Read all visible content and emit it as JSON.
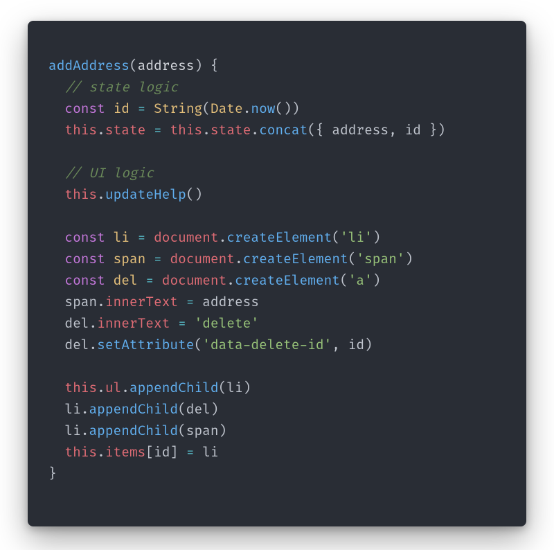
{
  "colors": {
    "bg": "#292d35",
    "fn": "#61afef",
    "comment": "#6b8a5a",
    "keyword": "#c678dd",
    "variable": "#e5c07b",
    "class": "#e5c07b",
    "operator": "#56b6c2",
    "this": "#e06c75",
    "prop": "#e06c75",
    "object": "#e06c75",
    "string": "#98c379",
    "default": "#c0c5ce"
  },
  "code": {
    "lines": [
      [
        {
          "cls": "c-fn",
          "t": "addAddress"
        },
        {
          "cls": "c-punct",
          "t": "("
        },
        {
          "cls": "c-param",
          "t": "address"
        },
        {
          "cls": "c-punct",
          "t": ") {"
        }
      ],
      [
        {
          "cls": "c-punct",
          "t": "  "
        },
        {
          "cls": "c-comment",
          "t": "// state logic"
        }
      ],
      [
        {
          "cls": "c-punct",
          "t": "  "
        },
        {
          "cls": "c-kw",
          "t": "const"
        },
        {
          "cls": "c-punct",
          "t": " "
        },
        {
          "cls": "c-var",
          "t": "id"
        },
        {
          "cls": "c-punct",
          "t": " "
        },
        {
          "cls": "c-op",
          "t": "="
        },
        {
          "cls": "c-punct",
          "t": " "
        },
        {
          "cls": "c-cls",
          "t": "String"
        },
        {
          "cls": "c-punct",
          "t": "("
        },
        {
          "cls": "c-cls",
          "t": "Date"
        },
        {
          "cls": "c-punct",
          "t": "."
        },
        {
          "cls": "c-fn",
          "t": "now"
        },
        {
          "cls": "c-punct",
          "t": "())"
        }
      ],
      [
        {
          "cls": "c-punct",
          "t": "  "
        },
        {
          "cls": "c-this",
          "t": "this"
        },
        {
          "cls": "c-punct",
          "t": "."
        },
        {
          "cls": "c-prop",
          "t": "state"
        },
        {
          "cls": "c-punct",
          "t": " "
        },
        {
          "cls": "c-op",
          "t": "="
        },
        {
          "cls": "c-punct",
          "t": " "
        },
        {
          "cls": "c-this",
          "t": "this"
        },
        {
          "cls": "c-punct",
          "t": "."
        },
        {
          "cls": "c-prop",
          "t": "state"
        },
        {
          "cls": "c-punct",
          "t": "."
        },
        {
          "cls": "c-fn",
          "t": "concat"
        },
        {
          "cls": "c-punct",
          "t": "({ address, id })"
        }
      ],
      [
        {
          "cls": "c-punct",
          "t": ""
        }
      ],
      [
        {
          "cls": "c-punct",
          "t": "  "
        },
        {
          "cls": "c-comment",
          "t": "// UI logic"
        }
      ],
      [
        {
          "cls": "c-punct",
          "t": "  "
        },
        {
          "cls": "c-this",
          "t": "this"
        },
        {
          "cls": "c-punct",
          "t": "."
        },
        {
          "cls": "c-fn",
          "t": "updateHelp"
        },
        {
          "cls": "c-punct",
          "t": "()"
        }
      ],
      [
        {
          "cls": "c-punct",
          "t": ""
        }
      ],
      [
        {
          "cls": "c-punct",
          "t": "  "
        },
        {
          "cls": "c-kw",
          "t": "const"
        },
        {
          "cls": "c-punct",
          "t": " "
        },
        {
          "cls": "c-var",
          "t": "li"
        },
        {
          "cls": "c-punct",
          "t": " "
        },
        {
          "cls": "c-op",
          "t": "="
        },
        {
          "cls": "c-punct",
          "t": " "
        },
        {
          "cls": "c-obj",
          "t": "document"
        },
        {
          "cls": "c-punct",
          "t": "."
        },
        {
          "cls": "c-fn",
          "t": "createElement"
        },
        {
          "cls": "c-punct",
          "t": "("
        },
        {
          "cls": "c-str",
          "t": "'li'"
        },
        {
          "cls": "c-punct",
          "t": ")"
        }
      ],
      [
        {
          "cls": "c-punct",
          "t": "  "
        },
        {
          "cls": "c-kw",
          "t": "const"
        },
        {
          "cls": "c-punct",
          "t": " "
        },
        {
          "cls": "c-var",
          "t": "span"
        },
        {
          "cls": "c-punct",
          "t": " "
        },
        {
          "cls": "c-op",
          "t": "="
        },
        {
          "cls": "c-punct",
          "t": " "
        },
        {
          "cls": "c-obj",
          "t": "document"
        },
        {
          "cls": "c-punct",
          "t": "."
        },
        {
          "cls": "c-fn",
          "t": "createElement"
        },
        {
          "cls": "c-punct",
          "t": "("
        },
        {
          "cls": "c-str",
          "t": "'span'"
        },
        {
          "cls": "c-punct",
          "t": ")"
        }
      ],
      [
        {
          "cls": "c-punct",
          "t": "  "
        },
        {
          "cls": "c-kw",
          "t": "const"
        },
        {
          "cls": "c-punct",
          "t": " "
        },
        {
          "cls": "c-var",
          "t": "del"
        },
        {
          "cls": "c-punct",
          "t": " "
        },
        {
          "cls": "c-op",
          "t": "="
        },
        {
          "cls": "c-punct",
          "t": " "
        },
        {
          "cls": "c-obj",
          "t": "document"
        },
        {
          "cls": "c-punct",
          "t": "."
        },
        {
          "cls": "c-fn",
          "t": "createElement"
        },
        {
          "cls": "c-punct",
          "t": "("
        },
        {
          "cls": "c-str",
          "t": "'a'"
        },
        {
          "cls": "c-punct",
          "t": ")"
        }
      ],
      [
        {
          "cls": "c-punct",
          "t": "  span."
        },
        {
          "cls": "c-prop",
          "t": "innerText"
        },
        {
          "cls": "c-punct",
          "t": " "
        },
        {
          "cls": "c-op",
          "t": "="
        },
        {
          "cls": "c-punct",
          "t": " address"
        }
      ],
      [
        {
          "cls": "c-punct",
          "t": "  del."
        },
        {
          "cls": "c-prop",
          "t": "innerText"
        },
        {
          "cls": "c-punct",
          "t": " "
        },
        {
          "cls": "c-op",
          "t": "="
        },
        {
          "cls": "c-punct",
          "t": " "
        },
        {
          "cls": "c-str",
          "t": "'delete'"
        }
      ],
      [
        {
          "cls": "c-punct",
          "t": "  del."
        },
        {
          "cls": "c-fn",
          "t": "setAttribute"
        },
        {
          "cls": "c-punct",
          "t": "("
        },
        {
          "cls": "c-str",
          "t": "'data-delete-id'"
        },
        {
          "cls": "c-punct",
          "t": ", id)"
        }
      ],
      [
        {
          "cls": "c-punct",
          "t": ""
        }
      ],
      [
        {
          "cls": "c-punct",
          "t": "  "
        },
        {
          "cls": "c-this",
          "t": "this"
        },
        {
          "cls": "c-punct",
          "t": "."
        },
        {
          "cls": "c-prop",
          "t": "ul"
        },
        {
          "cls": "c-punct",
          "t": "."
        },
        {
          "cls": "c-fn",
          "t": "appendChild"
        },
        {
          "cls": "c-punct",
          "t": "(li)"
        }
      ],
      [
        {
          "cls": "c-punct",
          "t": "  li."
        },
        {
          "cls": "c-fn",
          "t": "appendChild"
        },
        {
          "cls": "c-punct",
          "t": "(del)"
        }
      ],
      [
        {
          "cls": "c-punct",
          "t": "  li."
        },
        {
          "cls": "c-fn",
          "t": "appendChild"
        },
        {
          "cls": "c-punct",
          "t": "(span)"
        }
      ],
      [
        {
          "cls": "c-punct",
          "t": "  "
        },
        {
          "cls": "c-this",
          "t": "this"
        },
        {
          "cls": "c-punct",
          "t": "."
        },
        {
          "cls": "c-prop",
          "t": "items"
        },
        {
          "cls": "c-punct",
          "t": "[id] "
        },
        {
          "cls": "c-op",
          "t": "="
        },
        {
          "cls": "c-punct",
          "t": " li"
        }
      ],
      [
        {
          "cls": "c-punct",
          "t": "}"
        }
      ]
    ]
  }
}
